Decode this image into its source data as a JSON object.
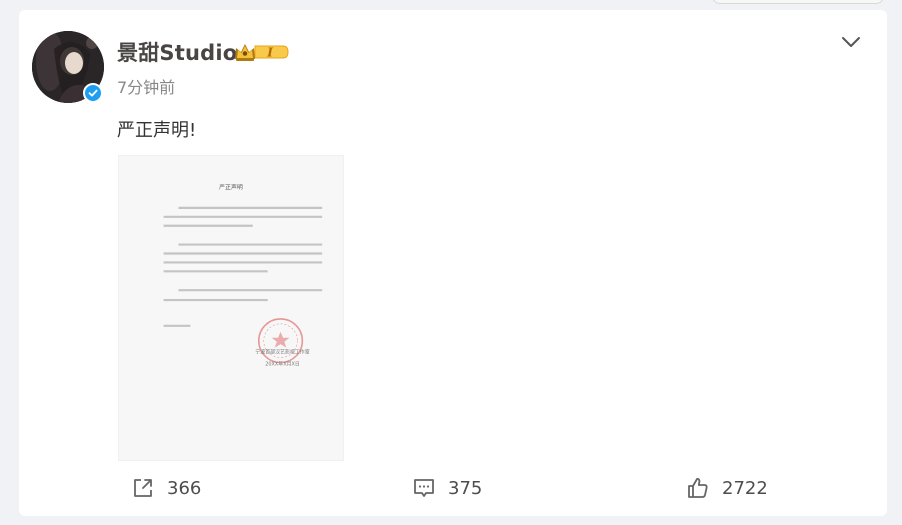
{
  "post": {
    "author": "景甜Studio",
    "vip_level": "I",
    "timestamp": "7分钟前",
    "text": "严正声明!",
    "menu_icon": "chevron-down-icon"
  },
  "document": {
    "title": "严正声明",
    "signature_org": "宁波首部汉艺影视工作室",
    "signature_date": "20XX年X月X日"
  },
  "actions": {
    "repost_count": "366",
    "comment_count": "375",
    "like_count": "2722"
  },
  "colors": {
    "verified": "#1e9ef2",
    "vip_gold": "#f5b51c",
    "seal_red": "#d94c4c"
  }
}
